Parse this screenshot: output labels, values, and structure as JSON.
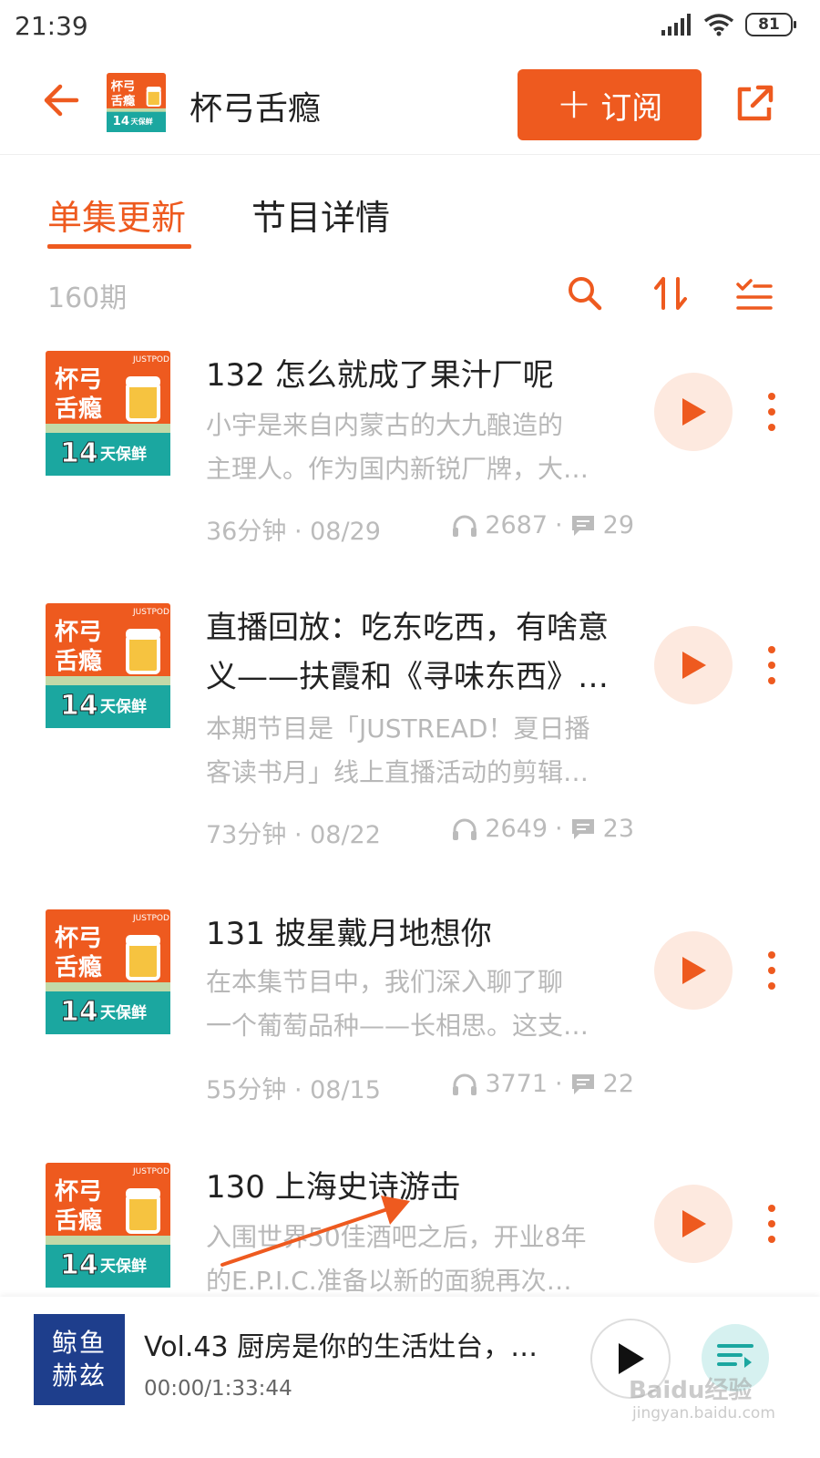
{
  "status_bar": {
    "time": "21:39",
    "battery": "81"
  },
  "header": {
    "title": "杯弓舌瘾",
    "subscribe_label": "订阅",
    "cover": {
      "line1": "杯弓",
      "line2": "舌瘾",
      "badge_num": "14",
      "badge_text": "天保鲜",
      "brand": "JUSTPOD"
    }
  },
  "tabs": [
    {
      "label": "单集更新",
      "active": true
    },
    {
      "label": "节目详情",
      "active": false
    }
  ],
  "toolbar": {
    "episode_count": "160期"
  },
  "episodes": [
    {
      "title": "132 怎么就成了果汁厂呢",
      "desc_line1": "小宇是来自内蒙古的大九酿造的",
      "desc_line2": "主理人。作为国内新锐厂牌，大…",
      "duration_date": "36分钟 · 08/29",
      "plays": "2687",
      "comments": "29"
    },
    {
      "title_line1": "直播回放：吃东吃西，有啥意",
      "title_line2": "义——扶霞和《寻味东西》…",
      "desc_line1": "本期节目是「JUSTREAD！夏日播",
      "desc_line2": "客读书月」线上直播活动的剪辑…",
      "duration_date": "73分钟 · 08/22",
      "plays": "2649",
      "comments": "23"
    },
    {
      "title": "131 披星戴月地想你",
      "desc_line1": "在本集节目中，我们深入聊了聊",
      "desc_line2": "一个葡萄品种——长相思。这支…",
      "duration_date": "55分钟 · 08/15",
      "plays": "3771",
      "comments": "22"
    },
    {
      "title": "130 上海史诗游击",
      "desc_line1": "入围世界50佳酒吧之后，开业8年",
      "desc_line2": "的E.P.I.C.准备以新的面貌再次…"
    }
  ],
  "mini_player": {
    "cover_line1": "鲸鱼",
    "cover_line2": "赫兹",
    "title": "Vol.43 厨房是你的生活灶台，…",
    "time": "00:00/1:33:44"
  },
  "watermark": {
    "text": "Baidu经验",
    "sub": "jingyan.baidu.com"
  },
  "colors": {
    "accent": "#ee5a1f",
    "play_bg": "#fde9df",
    "muted_text": "#bbbbbb"
  }
}
